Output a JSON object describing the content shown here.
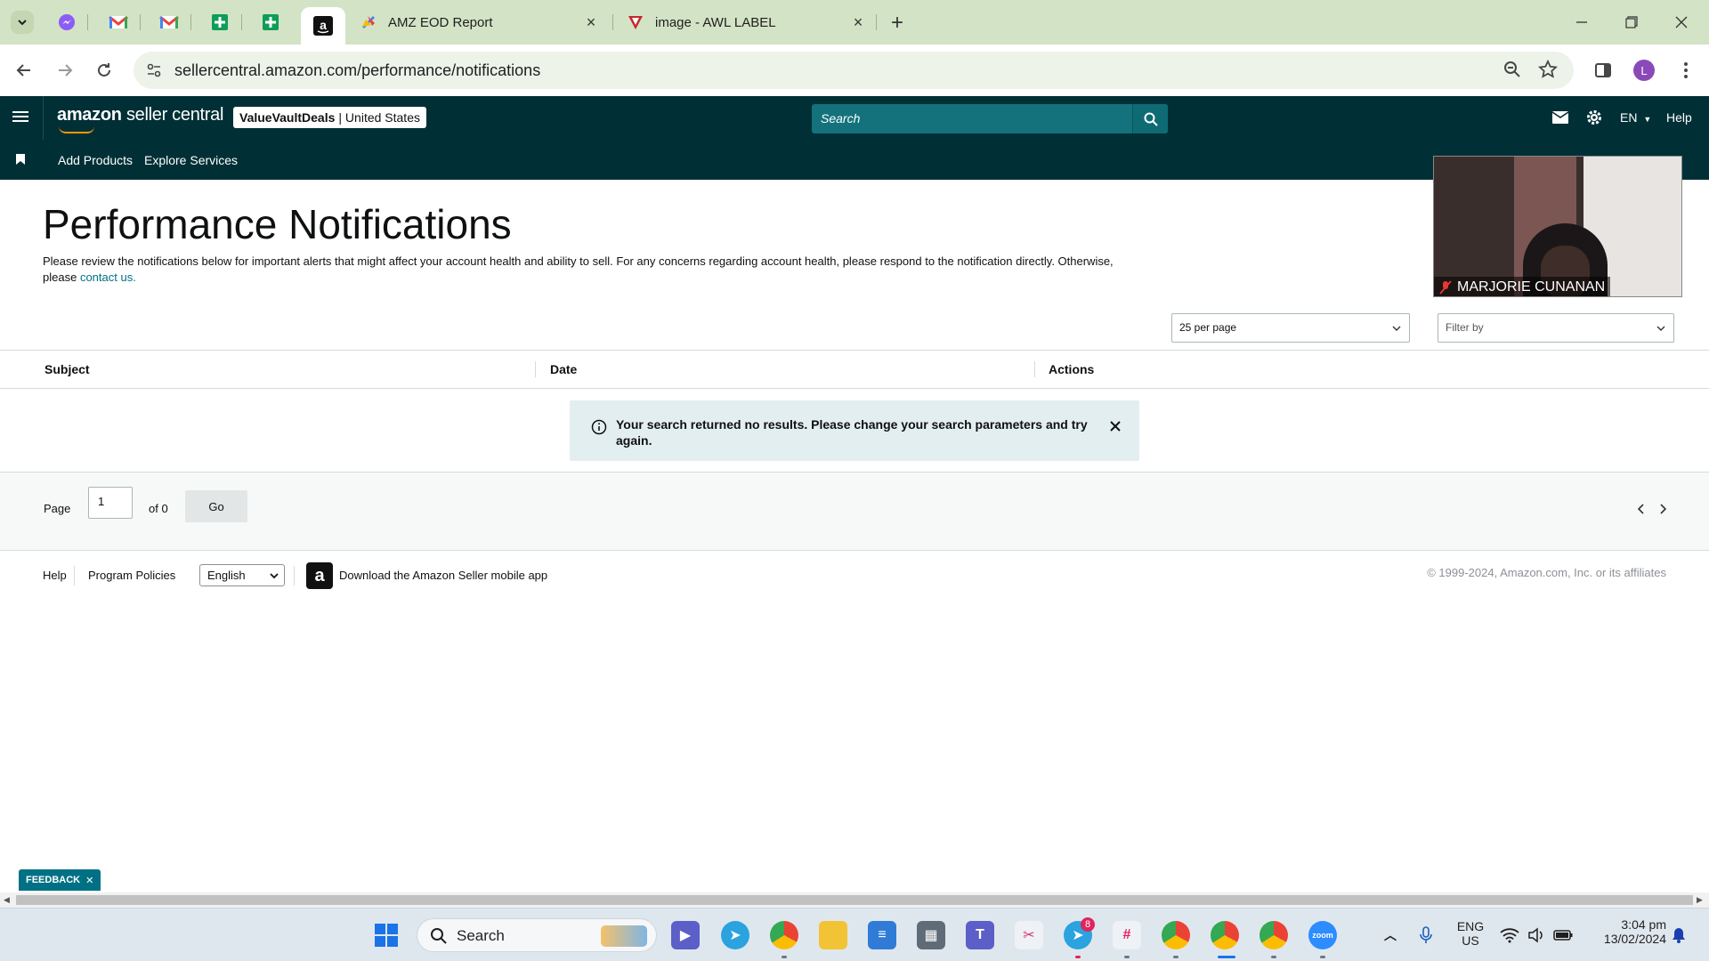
{
  "browser": {
    "tabs": [
      {
        "label": "AMZ EOD Report",
        "favicon": "zapier-like-icon"
      },
      {
        "label": "image - AWL LABEL",
        "favicon": "red-v-icon"
      }
    ],
    "pinned_tabs": [
      "messenger-icon",
      "gmail-icon",
      "gmail-icon",
      "google-sheets-icon",
      "google-sheets-icon",
      "amazon-icon"
    ],
    "url": "sellercentral.amazon.com/performance/notifications",
    "profile_initial": "L"
  },
  "header": {
    "logo_text_bold": "amazon",
    "logo_text": "seller central",
    "store_name": "ValueVaultDeals",
    "store_region": "| United States",
    "search_placeholder": "Search",
    "language": "EN",
    "help": "Help"
  },
  "subnav": {
    "items": [
      "Add Products",
      "Explore Services"
    ]
  },
  "page": {
    "title": "Performance Notifications",
    "description": "Please review the notifications below for important alerts that might affect your account health and ability to sell. For any concerns regarding account health, please respond to the notification directly. Otherwise, please",
    "contact_link": "contact us.",
    "per_page_select": "25 per page",
    "filter_placeholder": "Filter by"
  },
  "table": {
    "columns": [
      "Subject",
      "Date",
      "Actions"
    ],
    "alert_message": "Your search returned no results. Please change your search parameters and try again."
  },
  "pager": {
    "page_label": "Page",
    "page_value": "1",
    "of_label": "of 0",
    "go_label": "Go"
  },
  "footer": {
    "help": "Help",
    "program_policies": "Program Policies",
    "language_select": "English",
    "download_app": "Download the Amazon Seller mobile app",
    "copyright": "© 1999-2024, Amazon.com, Inc. or its affiliates"
  },
  "feedback": {
    "label": "FEEDBACK"
  },
  "video_call": {
    "participant_name": "MARJORIE CUNANAN"
  },
  "taskbar": {
    "search_label": "Search",
    "telegram_badge": "8",
    "lang_line1": "ENG",
    "lang_line2": "US",
    "time": "3:04 pm",
    "date": "13/02/2024"
  },
  "colors": {
    "header_bg": "#002f36",
    "search_bg": "#13727c",
    "link": "#007185",
    "alert_bg": "#e3eef1",
    "tabstrip_bg": "#d3e3c6"
  }
}
